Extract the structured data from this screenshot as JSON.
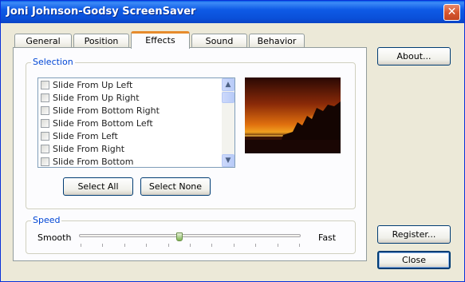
{
  "window": {
    "title": "Joni Johnson-Godsy ScreenSaver",
    "close_glyph": "✕"
  },
  "tabs": [
    {
      "label": "General"
    },
    {
      "label": "Position"
    },
    {
      "label": "Effects"
    },
    {
      "label": "Sound"
    },
    {
      "label": "Behavior"
    }
  ],
  "active_tab": "Effects",
  "selection": {
    "label": "Selection",
    "items": [
      {
        "label": "Slide From Up Left",
        "checked": false
      },
      {
        "label": "Slide From Up Right",
        "checked": false
      },
      {
        "label": "Slide From Bottom Right",
        "checked": false
      },
      {
        "label": "Slide From Bottom Left",
        "checked": false
      },
      {
        "label": "Slide From Left",
        "checked": false
      },
      {
        "label": "Slide From Right",
        "checked": false
      },
      {
        "label": "Slide From Bottom",
        "checked": false
      }
    ],
    "select_all_label": "Select All",
    "select_none_label": "Select None"
  },
  "speed": {
    "label": "Speed",
    "min_label": "Smooth",
    "max_label": "Fast",
    "value_fraction": 0.45,
    "tick_count": 11
  },
  "buttons": {
    "about": "About...",
    "register": "Register...",
    "close": "Close"
  },
  "colors": {
    "title_bar": "#0a5ee8",
    "active_tab_accent": "#e68b2c",
    "group_label": "#0046d5",
    "close_button": "#d6572f"
  }
}
